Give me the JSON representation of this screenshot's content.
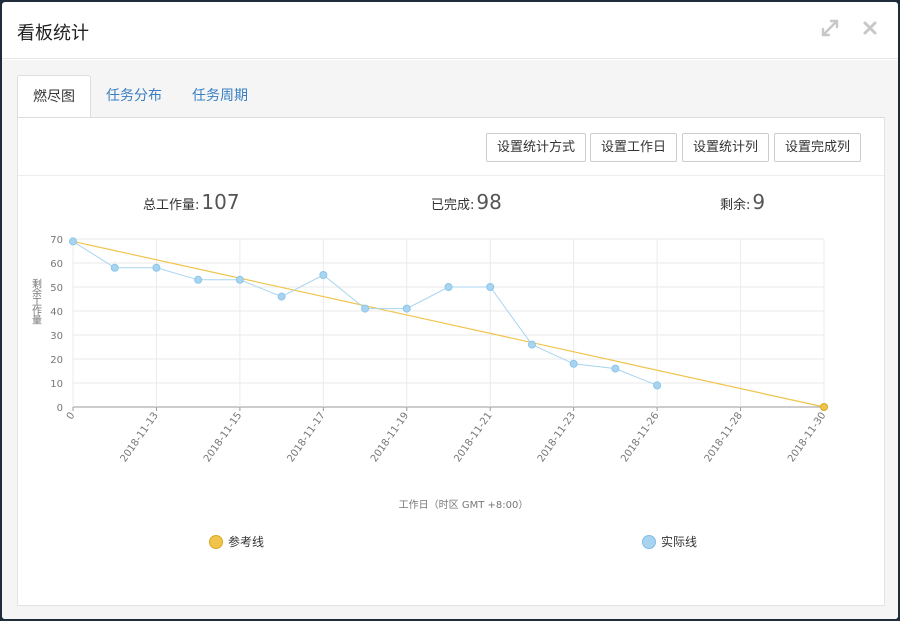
{
  "dialog": {
    "title": "看板统计"
  },
  "tabs": [
    {
      "label": "燃尽图",
      "active": true
    },
    {
      "label": "任务分布",
      "active": false
    },
    {
      "label": "任务周期",
      "active": false
    }
  ],
  "toolbar": {
    "stat_method": "设置统计方式",
    "workdays": "设置工作日",
    "stat_columns": "设置统计列",
    "done_columns": "设置完成列"
  },
  "stats": {
    "total_label": "总工作量:",
    "total_value": "107",
    "done_label": "已完成:",
    "done_value": "98",
    "remain_label": "剩余:",
    "remain_value": "9"
  },
  "chart_data": {
    "type": "line",
    "xlabel": "工作日（时区 GMT +8:00）",
    "ylabel": "剩余工作量",
    "ylim": [
      0,
      70
    ],
    "yticks": [
      0,
      10,
      20,
      30,
      40,
      50,
      60,
      70
    ],
    "x_tick_labels": [
      "0",
      "2018-11-13",
      "2018-11-15",
      "2018-11-17",
      "2018-11-19",
      "2018-11-21",
      "2018-11-23",
      "2018-11-26",
      "2018-11-28",
      "2018-11-30"
    ],
    "x_count": 19,
    "grid": true,
    "legend_position": "bottom",
    "series": [
      {
        "name": "参考线",
        "color": "#f0c34a",
        "x": [
          0,
          18
        ],
        "values": [
          69,
          0
        ]
      },
      {
        "name": "实际线",
        "color": "#a8d4f0",
        "x": [
          0,
          1,
          2,
          3,
          4,
          5,
          6,
          7,
          8,
          9,
          10,
          11,
          12,
          13,
          14
        ],
        "values": [
          69,
          58,
          58,
          53,
          53,
          46,
          55,
          41,
          41,
          50,
          50,
          26,
          18,
          16,
          9
        ]
      }
    ]
  },
  "colors": {
    "accent": "#3a7fc1",
    "reference": "#f0c34a",
    "actual": "#a8d4f0"
  }
}
